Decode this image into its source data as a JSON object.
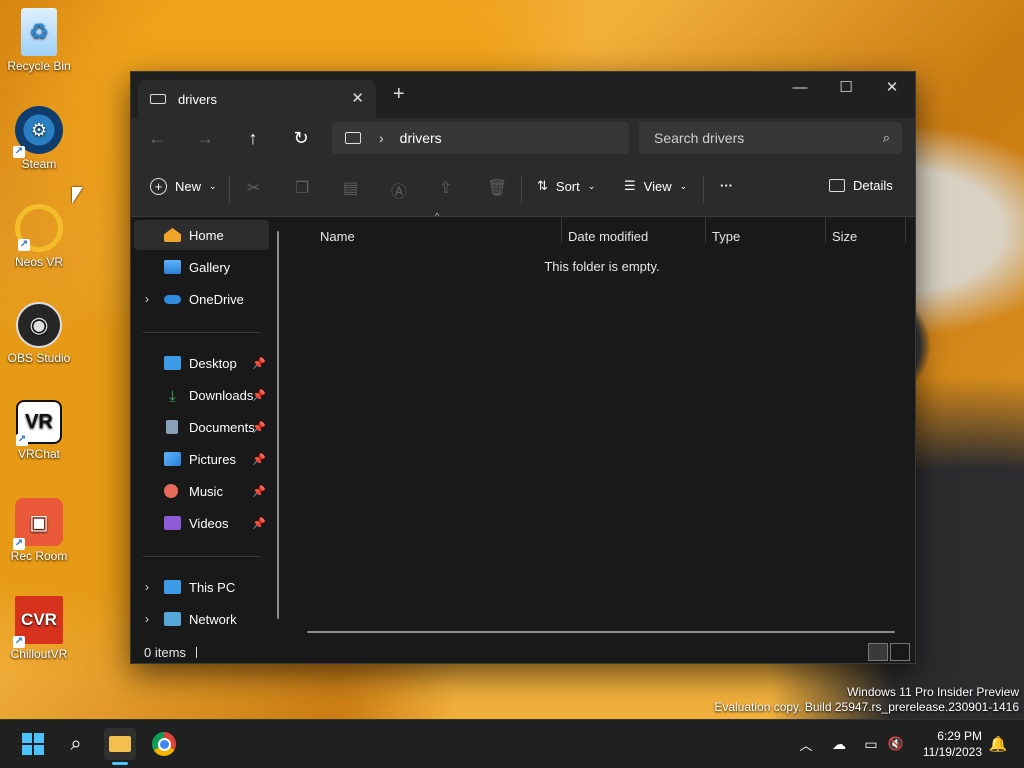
{
  "desktop": {
    "icons": [
      {
        "label": "Recycle Bin",
        "icon": "recycle-bin-icon",
        "color": "#bfe0ff"
      },
      {
        "label": "Steam",
        "icon": "steam-icon",
        "color": "#1b5d9b"
      },
      {
        "label": "Neos VR",
        "icon": "neos-vr-icon",
        "color": "#f0b01a"
      },
      {
        "label": "OBS Studio",
        "icon": "obs-studio-icon",
        "color": "#1b1b1b"
      },
      {
        "label": "VRChat",
        "icon": "vrchat-icon",
        "color": "#ffffff"
      },
      {
        "label": "Rec Room",
        "icon": "rec-room-icon",
        "color": "#ea5a3a"
      },
      {
        "label": "ChilloutVR",
        "icon": "chilloutvr-icon",
        "color": "#d6321e"
      }
    ],
    "watermark": {
      "line1": "Windows 11 Pro Insider Preview",
      "line2": "Evaluation copy. Build 25947.rs_prerelease.230901-1416"
    }
  },
  "window": {
    "tab_title": "drivers",
    "new_tab": "+",
    "controls": {
      "minimize": "—",
      "maximize": "☐",
      "close": "✕"
    },
    "nav": {
      "back": "←",
      "forward": "→",
      "up": "↑",
      "refresh": "↻"
    },
    "breadcrumb": {
      "separator": "›",
      "current": "drivers"
    },
    "search_placeholder": "Search drivers",
    "toolbar": {
      "new_label": "New",
      "sort_label": "Sort",
      "view_label": "View",
      "more_label": "···",
      "details_label": "Details"
    },
    "sidebar": {
      "top": [
        {
          "label": "Home",
          "icon": "home-icon",
          "color": "#f0a52a",
          "selected": true
        },
        {
          "label": "Gallery",
          "icon": "gallery-icon",
          "color": "#3a8fe0"
        },
        {
          "label": "OneDrive",
          "icon": "onedrive-icon",
          "color": "#2f8ae0",
          "expandable": true
        }
      ],
      "pinned": [
        {
          "label": "Desktop",
          "icon": "desktop-folder-icon",
          "color": "#3c9be6"
        },
        {
          "label": "Downloads",
          "icon": "downloads-icon",
          "color": "#3bb36d"
        },
        {
          "label": "Documents",
          "icon": "documents-icon",
          "color": "#8aa0b8"
        },
        {
          "label": "Pictures",
          "icon": "pictures-icon",
          "color": "#3a8fe0"
        },
        {
          "label": "Music",
          "icon": "music-icon",
          "color": "#e76a5a"
        },
        {
          "label": "Videos",
          "icon": "videos-icon",
          "color": "#8e5ad6"
        }
      ],
      "bottom": [
        {
          "label": "This PC",
          "icon": "this-pc-icon",
          "color": "#3c9be6"
        },
        {
          "label": "Network",
          "icon": "network-icon",
          "color": "#56a8d8"
        }
      ]
    },
    "columns": [
      "Name",
      "Date modified",
      "Type",
      "Size"
    ],
    "empty_message": "This folder is empty.",
    "status": "0 items"
  },
  "taskbar": {
    "time": "6:29 PM",
    "date": "11/19/2023"
  }
}
